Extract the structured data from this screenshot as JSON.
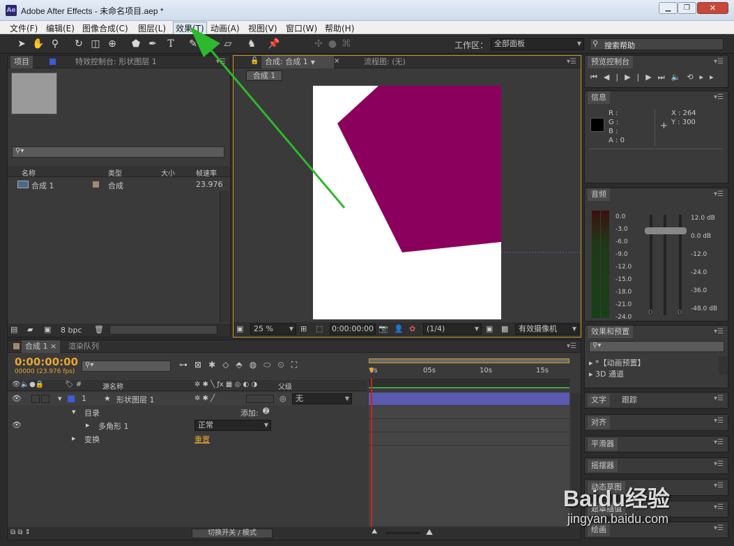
{
  "window": {
    "app_icon": "Ae",
    "title": "Adobe After Effects - 未命名项目.aep *",
    "controls": [
      "minimize-icon",
      "restore-icon",
      "close-icon"
    ]
  },
  "menu": [
    "文件(F)",
    "编辑(E)",
    "图像合成(C)",
    "图层(L)",
    "效果(T)",
    "动画(A)",
    "视图(V)",
    "窗口(W)",
    "帮助(H)"
  ],
  "toolbar": {
    "workspace_label": "工作区：",
    "workspace_value": "全部面板",
    "search_help": "搜索帮助"
  },
  "project_panel": {
    "tab_project": "项目",
    "tab_effects": "特效控制台: 形状图层 1",
    "columns": [
      "名称",
      "类型",
      "大小",
      "帧速率"
    ],
    "items": [
      {
        "name": "合成 1",
        "type": "合成",
        "size": "",
        "fps": "23.976"
      }
    ],
    "bpc": "8 bpc"
  },
  "comp_panel": {
    "tab_comp": "合成: 合成 1",
    "tab_flow": "流程图: (无)",
    "breadcrumb": "合成 1",
    "zoom": "25 %",
    "timecode": "0:00:00:00",
    "resolution": "(1/4)",
    "camera": "有效摄像机",
    "shape_color": "#8b005d",
    "canvas_color": "#ffffff"
  },
  "preview_panel": {
    "tab": "预览控制台"
  },
  "info_panel": {
    "tab": "信息",
    "r": "R :",
    "g": "G :",
    "b": "B :",
    "a": "A : 0",
    "x": "X : 264",
    "y": "Y : 300"
  },
  "audio_panel": {
    "tab": "音频",
    "left_scale": [
      "0.0",
      "-3.0",
      "-6.0",
      "-9.0",
      "-12.0",
      "-15.0",
      "-18.0",
      "-21.0",
      "-24.0"
    ],
    "right_scale": [
      "12.0 dB",
      "0.0 dB",
      "-12.0",
      "-24.0",
      "-36.0",
      "-48.0 dB"
    ],
    "zeros": [
      "0",
      "0"
    ]
  },
  "effects_panel": {
    "tab": "效果和预置",
    "items": [
      "*【动画预置】",
      "3D 通道"
    ]
  },
  "side_tabs": [
    "文字",
    "跟踪",
    "对齐",
    "平滑器",
    "摇摆器",
    "动态草图",
    "遮罩插值",
    "绘画"
  ],
  "timeline": {
    "tab_comp": "合成 1",
    "tab_render": "渲染队列",
    "timecode": "0:00:00:00",
    "fps": "00000 (23.976 fps)",
    "col_source": "源名称",
    "col_parent": "父级",
    "ruler": [
      "0s",
      "05s",
      "10s",
      "15s"
    ],
    "layers": [
      {
        "num": "1",
        "name": "形状图层 1",
        "parent": "无"
      }
    ],
    "sub": {
      "contents": "目录",
      "add": "添加:",
      "polygon": "多角形 1",
      "blend": "正常",
      "transform": "变换",
      "reset": "重置"
    },
    "toggle": "切换开关 / 模式"
  },
  "watermark": {
    "brand": "Baidu经验",
    "url": "jingyan.baidu.com"
  }
}
